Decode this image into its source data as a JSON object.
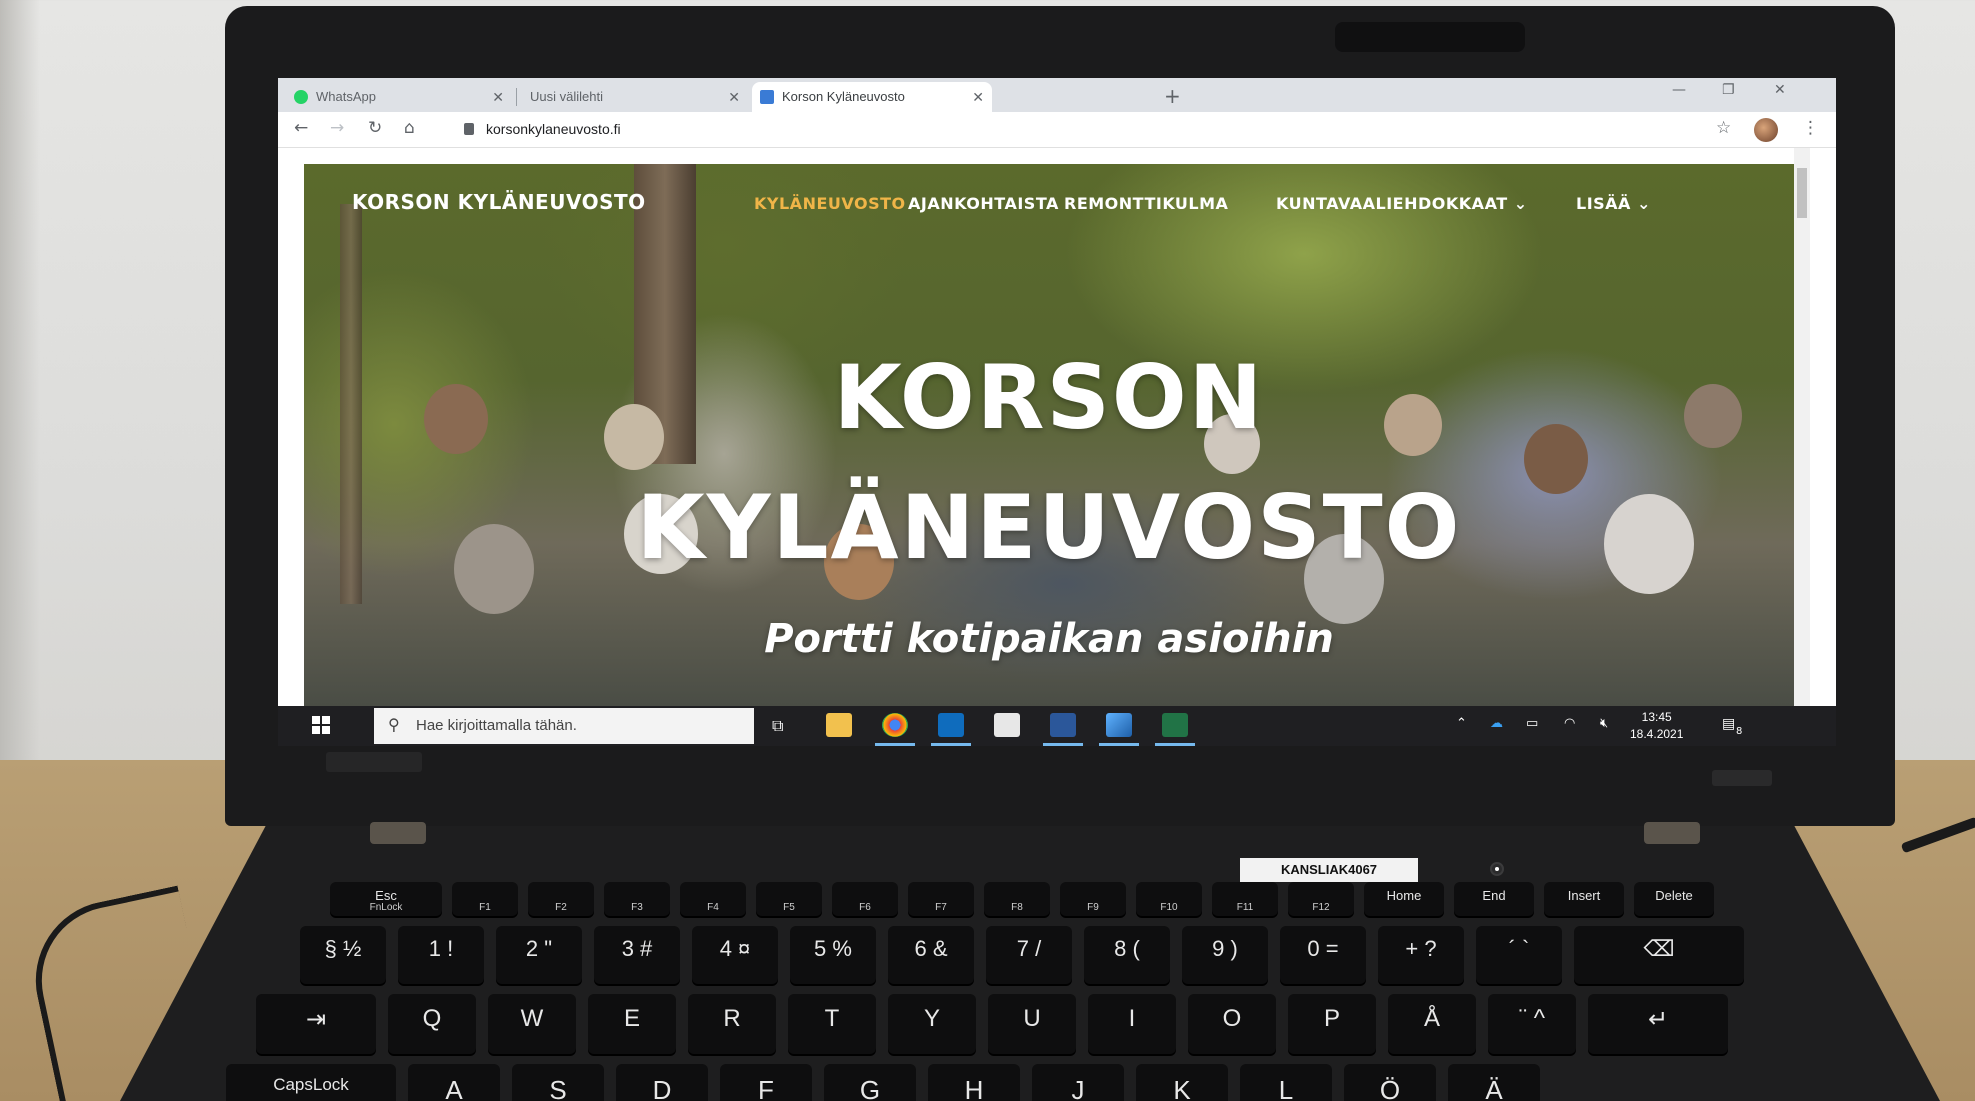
{
  "browser": {
    "tabs": [
      {
        "title": "WhatsApp",
        "icon": "whatsapp-icon",
        "active": false
      },
      {
        "title": "Uusi välilehti",
        "icon": "new-tab-icon",
        "active": false
      },
      {
        "title": "Korson Kyläneuvosto",
        "icon": "site-favicon",
        "active": true
      }
    ],
    "new_tab_label": "+",
    "url": "korsonkylaneuvosto.fi"
  },
  "site": {
    "logo": "KORSON KYLÄNEUVOSTO",
    "nav": [
      {
        "label": "KYLÄNEUVOSTO",
        "active": true
      },
      {
        "label": "AJANKOHTAISTA",
        "active": false
      },
      {
        "label": "REMONTTIKULMA",
        "active": false
      },
      {
        "label": "KUNTAVAALIEHDOKKAAT ⌄",
        "active": false
      },
      {
        "label": "LISÄÄ ⌄",
        "active": false
      }
    ],
    "hero_line1": "KORSON",
    "hero_line2": "KYLÄNEUVOSTO",
    "hero_subtitle": "Portti kotipaikan asioihin",
    "accent_color": "#f0b548"
  },
  "taskbar": {
    "search_placeholder": "Hae kirjoittamalla tähän.",
    "time": "13:45",
    "date": "18.4.2021",
    "notification_count": "8"
  },
  "device": {
    "asset_tag": "KANSLIAK4067"
  },
  "keyboard": {
    "function_row": [
      {
        "main": "Esc",
        "sub": "FnLock"
      },
      {
        "main": "",
        "sub": "F1"
      },
      {
        "main": "",
        "sub": "F2"
      },
      {
        "main": "",
        "sub": "F3"
      },
      {
        "main": "",
        "sub": "F4"
      },
      {
        "main": "",
        "sub": "F5"
      },
      {
        "main": "",
        "sub": "F6"
      },
      {
        "main": "",
        "sub": "F7"
      },
      {
        "main": "",
        "sub": "F8"
      },
      {
        "main": "",
        "sub": "F9"
      },
      {
        "main": "",
        "sub": "F10"
      },
      {
        "main": "",
        "sub": "F11"
      },
      {
        "main": "",
        "sub": "F12"
      },
      {
        "main": "Home",
        "sub": ""
      },
      {
        "main": "End",
        "sub": ""
      },
      {
        "main": "Insert",
        "sub": ""
      },
      {
        "main": "Delete",
        "sub": ""
      }
    ],
    "number_row": [
      "§ ½",
      "1 !",
      "2 \"",
      "3 #",
      "4 ¤",
      "5 %",
      "6 &",
      "7 /",
      "8 (",
      "9 )",
      "0 =",
      "+ ?",
      "´ `",
      "⌫"
    ],
    "qwerty_row": [
      "⇥",
      "Q",
      "W",
      "E",
      "R",
      "T",
      "Y",
      "U",
      "I",
      "O",
      "P",
      "Å",
      "¨ ^",
      "↵"
    ],
    "home_row": [
      "CapsLock",
      "A",
      "S",
      "D",
      "F",
      "G",
      "H",
      "J",
      "K",
      "L",
      "Ö",
      "Ä"
    ]
  }
}
